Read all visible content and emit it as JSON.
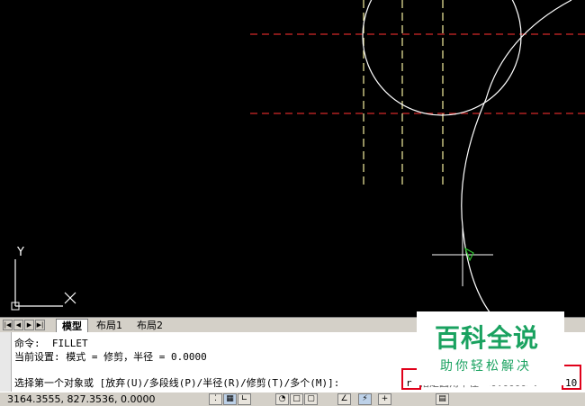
{
  "tabs": {
    "nav": [
      "|◀",
      "◀",
      "▶",
      "▶|"
    ],
    "items": [
      {
        "label": "模型",
        "active": true
      },
      {
        "label": "布局1",
        "active": false
      },
      {
        "label": "布局2",
        "active": false
      }
    ]
  },
  "ucs": {
    "y_label": "Y"
  },
  "command": {
    "line1": "命令:  FILLET",
    "line2": "当前设置: 模式 = 修剪，半径 = 0.0000",
    "line3_prompt": "选择第一个对象或 [放弃(U)/多段线(P)/半径(R)/修剪(T)/多个(M)]:",
    "line3_input": "r",
    "line3_radius_prompt": "指定圆角半径 <0.0000>:",
    "line3_radius_value": "10"
  },
  "watermark": {
    "title": "百科全说",
    "subtitle": "助你轻松解决"
  },
  "status": {
    "coords": "3164.3555, 827.3536, 0.0000",
    "toggle_icons": [
      "snap-icon",
      "grid-icon",
      "ortho-icon",
      "polar-icon",
      "osnap-icon",
      "otrack-icon",
      "ducs-icon",
      "dyn-icon",
      "lwt-icon",
      "model-icon"
    ]
  },
  "colors": {
    "canvas": "#000000",
    "geometry": "#ffffff",
    "hidden_line_red": "#d22828",
    "hidden_line_yellow": "#f5f0a0",
    "cursor_green": "#2fbf2f",
    "highlight_box": "#e0001a",
    "watermark": "#1aa260"
  }
}
